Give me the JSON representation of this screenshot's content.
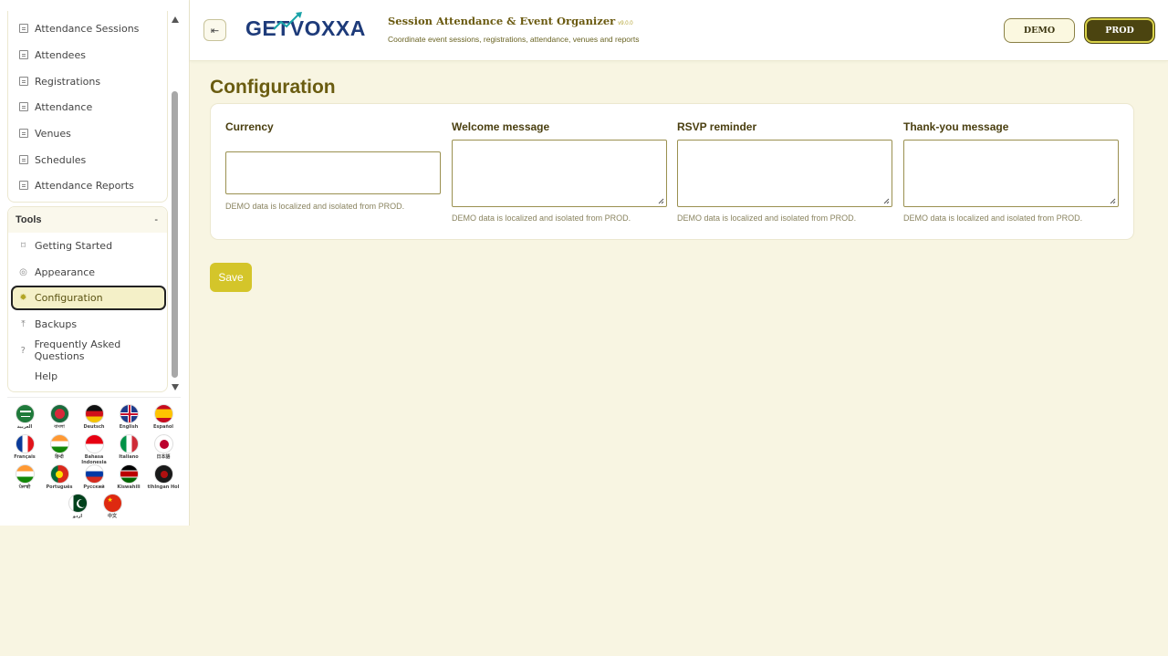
{
  "sidebar": {
    "items": [
      {
        "label": "Attendance Sessions"
      },
      {
        "label": "Attendees"
      },
      {
        "label": "Registrations"
      },
      {
        "label": "Attendance"
      },
      {
        "label": "Venues"
      },
      {
        "label": "Schedules"
      },
      {
        "label": "Attendance Reports"
      }
    ],
    "tools": {
      "heading": "Tools",
      "toggle": "-",
      "items": [
        {
          "label": "Getting Started",
          "icon": "signpost-icon"
        },
        {
          "label": "Appearance",
          "icon": "palette-icon"
        },
        {
          "label": "Configuration",
          "icon": "gear-icon",
          "active": true
        },
        {
          "label": "Backups",
          "icon": "upload-icon"
        },
        {
          "label": "Frequently Asked Questions",
          "icon": "help-circle-icon"
        },
        {
          "label": "Help",
          "icon": ""
        }
      ]
    },
    "languages": [
      {
        "label": "العربية"
      },
      {
        "label": "বাংলা"
      },
      {
        "label": "Deutsch"
      },
      {
        "label": "English"
      },
      {
        "label": "Español"
      },
      {
        "label": "Français"
      },
      {
        "label": "हिन्दी"
      },
      {
        "label": "Bahasa Indonesia"
      },
      {
        "label": "Italiano"
      },
      {
        "label": "日本語"
      },
      {
        "label": "ਪੰਜਾਬੀ"
      },
      {
        "label": "Português"
      },
      {
        "label": "Русский"
      },
      {
        "label": "Kiswahili"
      },
      {
        "label": "tlhIngan Hol"
      },
      {
        "label": "اردو"
      },
      {
        "label": "中文"
      }
    ]
  },
  "header": {
    "logo_text_1": "GET",
    "logo_text_2": "OXXA",
    "logo_v": "V",
    "app_title": "Session Attendance & Event Organizer",
    "version": "v9.0.0",
    "subtitle": "Coordinate event sessions, registrations, attendance, venues and reports",
    "demo_label": "DEMO",
    "prod_label": "PROD",
    "collapse_icon": "collapse-menu-icon"
  },
  "main": {
    "page_title": "Configuration",
    "fields": [
      {
        "label": "Currency",
        "value": "",
        "hint": "DEMO data is localized and isolated from PROD."
      },
      {
        "label": "Welcome message",
        "value": "",
        "hint": "DEMO data is localized and isolated from PROD."
      },
      {
        "label": "RSVP reminder",
        "value": "",
        "hint": "DEMO data is localized and isolated from PROD."
      },
      {
        "label": "Thank-you message",
        "value": "",
        "hint": "DEMO data is localized and isolated from PROD."
      }
    ],
    "save_label": "Save"
  },
  "colors": {
    "accent": "#d4c52a",
    "title": "#6a5c10",
    "background": "#f8f5e2",
    "prod_bg": "#4b4410"
  }
}
